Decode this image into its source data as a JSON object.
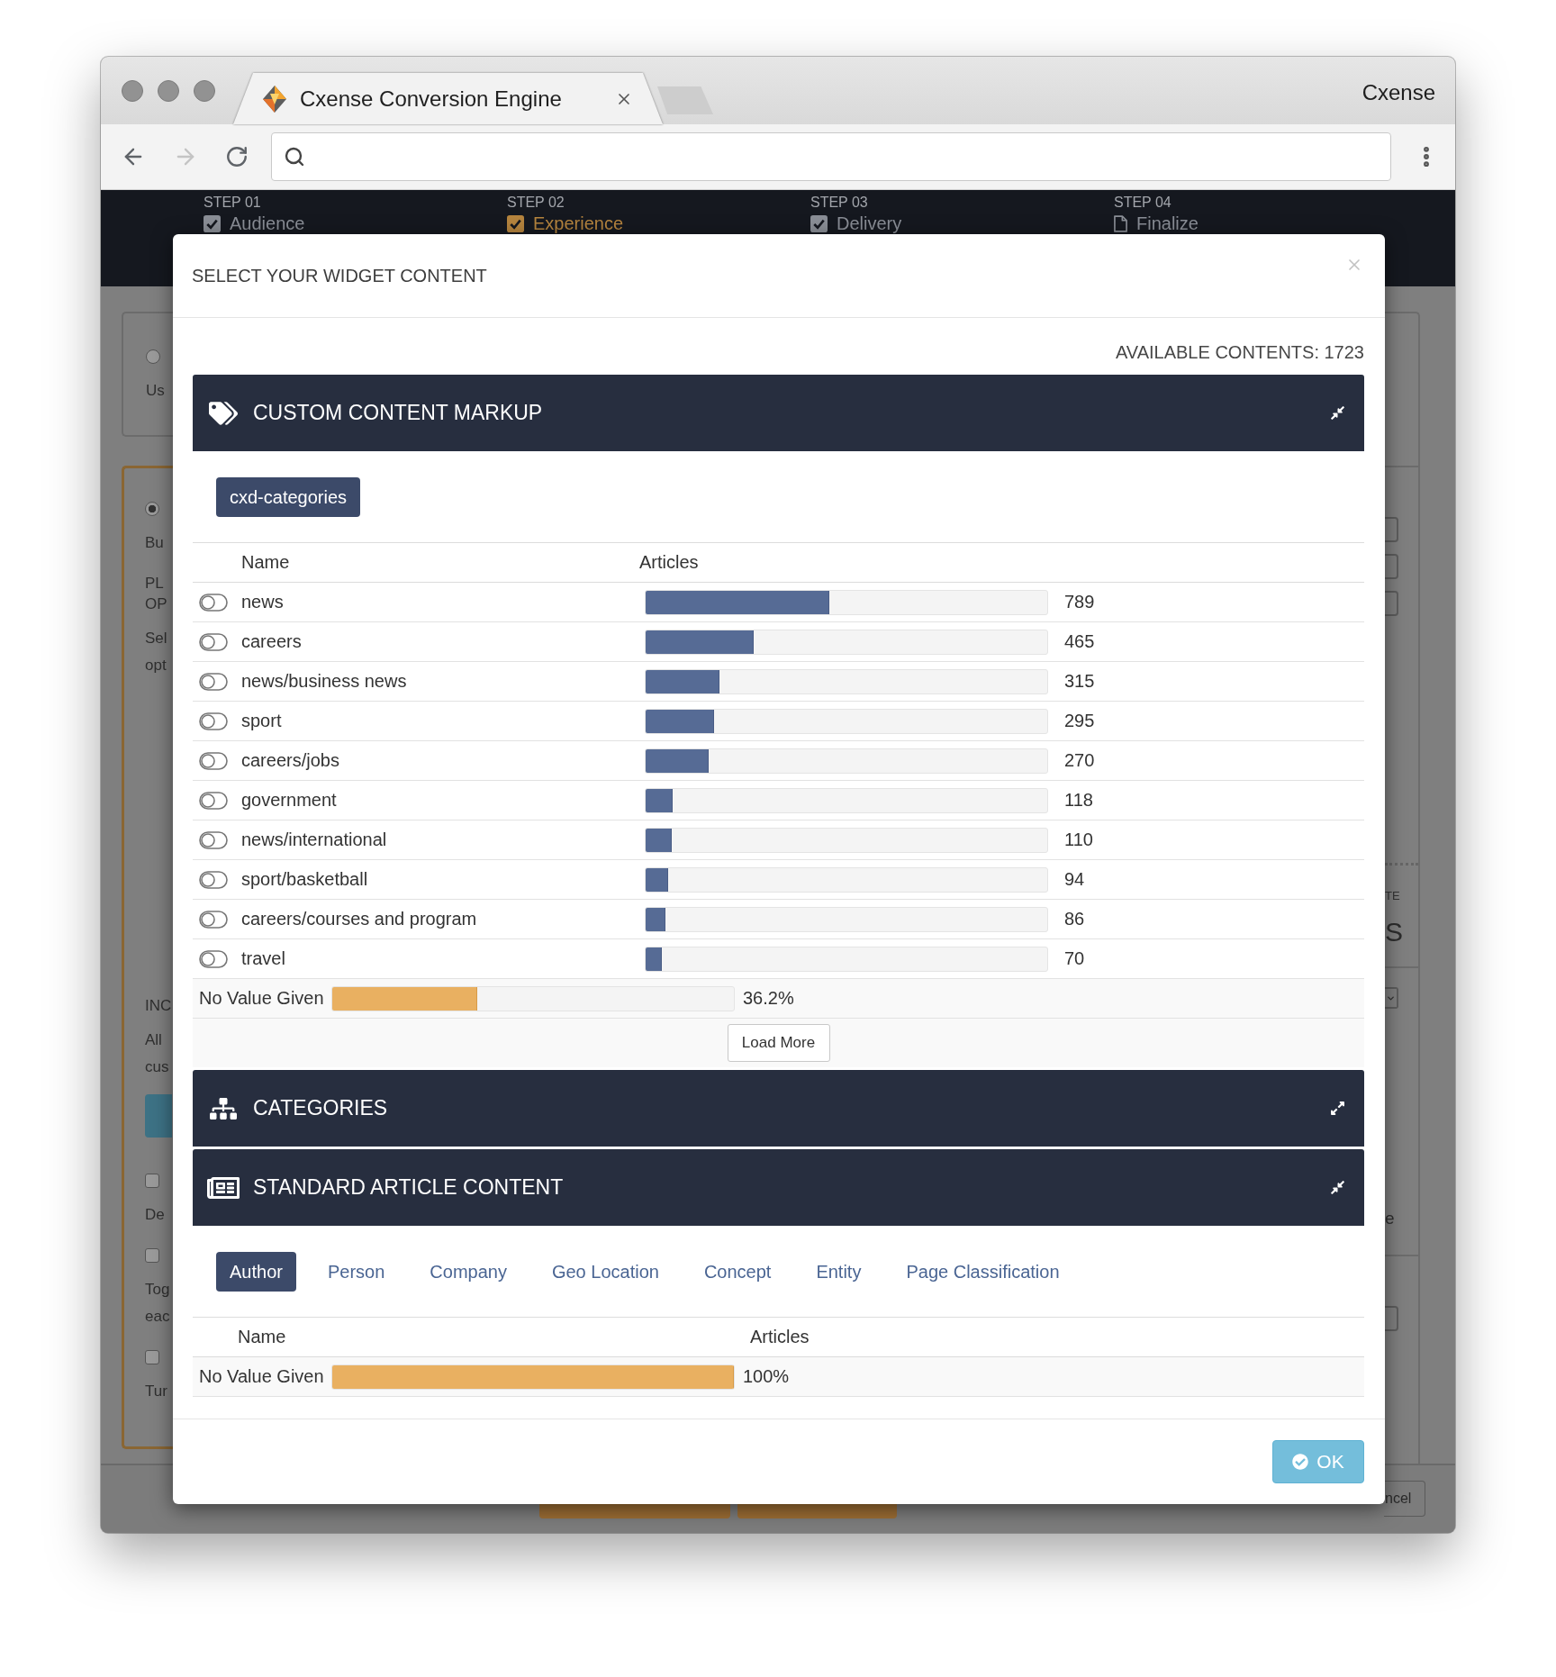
{
  "browser": {
    "tab_title": "Cxense Conversion Engine",
    "profile": "Cxense"
  },
  "steps": [
    {
      "number": "STEP 01",
      "label": "Audience",
      "done": true,
      "selected": false
    },
    {
      "number": "STEP 02",
      "label": "Experience",
      "done": true,
      "selected": true
    },
    {
      "number": "STEP 03",
      "label": "Delivery",
      "done": true,
      "selected": false
    },
    {
      "number": "STEP 04",
      "label": "Finalize",
      "done": false,
      "selected": false
    }
  ],
  "background": {
    "left_panels": [
      {
        "selected": false,
        "top_items": [
          {
            "kind": "radio",
            "checked": false
          },
          {
            "kind": "text",
            "lines": [
              "Us"
            ]
          }
        ]
      },
      {
        "selected": true,
        "top_items": [
          {
            "kind": "radio",
            "checked": true
          },
          {
            "kind": "text",
            "lines": [
              "Bu"
            ]
          },
          {
            "kind": "heading",
            "lines": [
              "PL",
              "OP"
            ]
          },
          {
            "kind": "text",
            "lines": [
              "Sel",
              "opt"
            ]
          }
        ],
        "bottom_items": [
          {
            "kind": "heading",
            "lines": [
              "INC"
            ]
          },
          {
            "kind": "text",
            "lines": [
              "All",
              "cus"
            ]
          },
          {
            "kind": "button"
          },
          {
            "kind": "checkbox",
            "checked": false
          },
          {
            "kind": "text",
            "lines": [
              "De"
            ]
          },
          {
            "kind": "checkbox",
            "checked": false
          },
          {
            "kind": "text",
            "lines": [
              "Tog",
              "eac"
            ]
          },
          {
            "kind": "checkbox",
            "checked": false
          },
          {
            "kind": "text",
            "lines": [
              "Tur"
            ]
          }
        ]
      }
    ],
    "right_items": [
      {
        "kind": "panel-break"
      },
      {
        "kind": "button-edge"
      },
      {
        "kind": "button-edge"
      },
      {
        "kind": "button-edge"
      },
      {
        "kind": "dotted-rule"
      },
      {
        "kind": "caption",
        "text": "TE"
      },
      {
        "kind": "large",
        "text": "S"
      },
      {
        "kind": "rule"
      },
      {
        "kind": "dropdown-edge"
      },
      {
        "kind": "text",
        "text": "e"
      },
      {
        "kind": "panel-break"
      },
      {
        "kind": "button-edge"
      }
    ],
    "footer_button": "ncel"
  },
  "modal": {
    "title": "SELECT YOUR WIDGET CONTENT",
    "available": "AVAILABLE CONTENTS: 1723",
    "sections": [
      {
        "kind": "markup",
        "title": "CUSTOM CONTENT MARKUP",
        "expanded": true,
        "filters": [
          {
            "label": "cxd-categories",
            "selected": true
          }
        ],
        "table": {
          "columns": [
            "Name",
            "Articles"
          ],
          "rows": [
            {
              "name": "news",
              "on": false,
              "level": 0.458,
              "count": "789"
            },
            {
              "name": "careers",
              "on": false,
              "level": 0.27,
              "count": "465"
            },
            {
              "name": "news/business news",
              "on": false,
              "level": 0.183,
              "count": "315"
            },
            {
              "name": "sport",
              "on": false,
              "level": 0.171,
              "count": "295"
            },
            {
              "name": "careers/jobs",
              "on": false,
              "level": 0.157,
              "count": "270"
            },
            {
              "name": "government",
              "on": false,
              "level": 0.068,
              "count": "118"
            },
            {
              "name": "news/international",
              "on": false,
              "level": 0.064,
              "count": "110"
            },
            {
              "name": "sport/basketball",
              "on": false,
              "level": 0.055,
              "count": "94"
            },
            {
              "name": "careers/courses and program",
              "on": false,
              "level": 0.05,
              "count": "86"
            },
            {
              "name": "travel",
              "on": false,
              "level": 0.041,
              "count": "70"
            }
          ],
          "no_value": {
            "label": "No Value Given",
            "level": 0.362,
            "reading": "36.2%"
          },
          "load_more": "Load More"
        }
      },
      {
        "kind": "categories",
        "title": "CATEGORIES",
        "expanded": false
      },
      {
        "kind": "article",
        "title": "STANDARD ARTICLE CONTENT",
        "expanded": true,
        "filters": [
          {
            "label": "Author",
            "selected": true
          },
          {
            "label": "Person",
            "selected": false
          },
          {
            "label": "Company",
            "selected": false
          },
          {
            "label": "Geo Location",
            "selected": false
          },
          {
            "label": "Concept",
            "selected": false
          },
          {
            "label": "Entity",
            "selected": false
          },
          {
            "label": "Page Classification",
            "selected": false
          }
        ],
        "table": {
          "columns": [
            "Name",
            "Articles"
          ],
          "no_value": {
            "label": "No Value Given",
            "level": 1,
            "reading": "100%"
          }
        }
      }
    ],
    "ok": "OK"
  }
}
